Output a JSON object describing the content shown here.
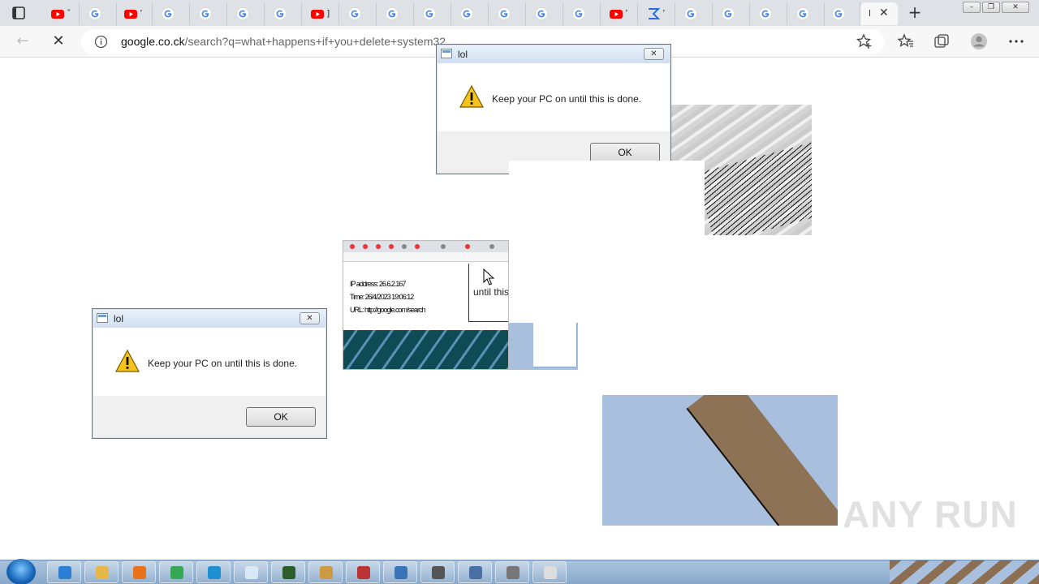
{
  "browser": {
    "tabs": [
      {
        "icon": "youtube-icon",
        "tail": "ˇ"
      },
      {
        "icon": "google-icon",
        "tail": ""
      },
      {
        "icon": "youtube-icon",
        "tail": "ʼ"
      },
      {
        "icon": "google-icon",
        "tail": ""
      },
      {
        "icon": "google-icon",
        "tail": ""
      },
      {
        "icon": "google-icon",
        "tail": ""
      },
      {
        "icon": "google-icon",
        "tail": ""
      },
      {
        "icon": "youtube-icon",
        "tail": "]"
      },
      {
        "icon": "google-icon",
        "tail": ""
      },
      {
        "icon": "google-icon",
        "tail": ""
      },
      {
        "icon": "google-icon",
        "tail": ""
      },
      {
        "icon": "google-icon",
        "tail": ""
      },
      {
        "icon": "google-icon",
        "tail": ""
      },
      {
        "icon": "google-icon",
        "tail": ""
      },
      {
        "icon": "google-icon",
        "tail": ""
      },
      {
        "icon": "youtube-icon",
        "tail": "ʼ"
      },
      {
        "icon": "sigma-icon",
        "tail": "ʼ"
      },
      {
        "icon": "google-icon",
        "tail": ""
      },
      {
        "icon": "google-icon",
        "tail": ""
      },
      {
        "icon": "google-icon",
        "tail": ""
      },
      {
        "icon": "google-icon",
        "tail": ""
      },
      {
        "icon": "google-icon",
        "tail": ""
      }
    ],
    "active_tab": {
      "text": "l",
      "close": "✕"
    },
    "new_tab": "+",
    "window_controls": {
      "minimize": "–",
      "restore": "❐",
      "close": "✕"
    },
    "url_host": "google.co.ck",
    "url_path": "/search?q=what+happens+if+you+delete+system32"
  },
  "dialogs": [
    {
      "title": "lol",
      "message": "Keep your PC on until this is done.",
      "ok": "OK",
      "close": "✕"
    },
    {
      "title": "lol",
      "message": "Keep your PC on until this is done.",
      "ok": "OK",
      "close": "✕"
    }
  ],
  "glitch_snapshot": {
    "lines": [
      "IP address: 26.6.2.167",
      "Time: 26/4/2023 19:06:12",
      "URL: http://google.com/search"
    ],
    "dialog_fragment": "until this"
  },
  "watermark": "ANY RUN",
  "taskbar": {
    "items": [
      "ie-icon",
      "folder-icon",
      "media-player-icon",
      "chrome-icon",
      "edge-icon",
      "notepad-icon",
      "terminal-icon",
      "installer-icon",
      "archive-icon",
      "remote-desktop-icon",
      "tool-icon",
      "document-icon",
      "calculator-icon",
      "file-icon"
    ]
  },
  "colors": {
    "tabstrip": "#dee1e6",
    "youtube": "#ff0000",
    "google_blue": "#4285f4",
    "dialog_footer": "#f0f0f0",
    "taskbar": "#a9c3dd"
  }
}
